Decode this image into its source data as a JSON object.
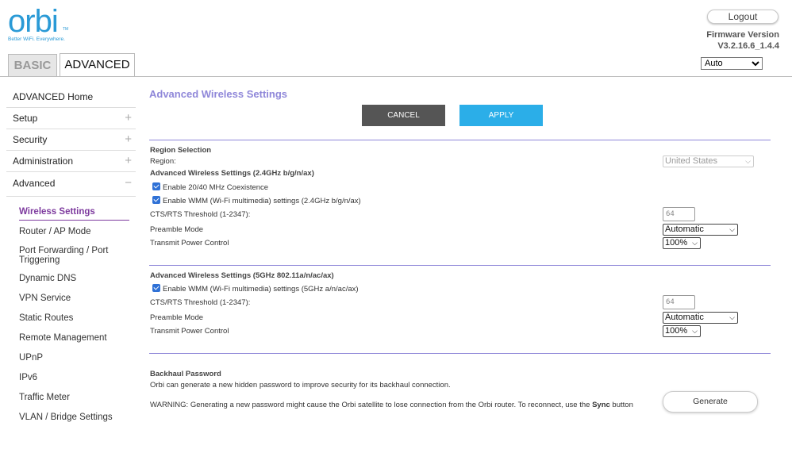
{
  "brand": {
    "logo": "orbi",
    "tm": "TM",
    "tagline": "Better WiFi. Everywhere."
  },
  "header": {
    "logout": "Logout",
    "firmware_label": "Firmware Version",
    "firmware_version": "V3.2.16.6_1.4.4",
    "language_selected": "Auto"
  },
  "tabs": [
    {
      "label": "BASIC"
    },
    {
      "label": "ADVANCED"
    }
  ],
  "sidebar": {
    "top": [
      {
        "label": "ADVANCED Home",
        "sign": ""
      },
      {
        "label": "Setup",
        "sign": "+"
      },
      {
        "label": "Security",
        "sign": "+"
      },
      {
        "label": "Administration",
        "sign": "+"
      },
      {
        "label": "Advanced",
        "sign": "−"
      }
    ],
    "sub": [
      "Wireless Settings",
      "Router / AP Mode",
      "Port Forwarding / Port Triggering",
      "Dynamic DNS",
      "VPN Service",
      "Static Routes",
      "Remote Management",
      "UPnP",
      "IPv6",
      "Traffic Meter",
      "VLAN / Bridge Settings"
    ]
  },
  "main": {
    "title": "Advanced Wireless Settings",
    "cancel": "CANCEL",
    "apply": "APPLY",
    "region": {
      "heading": "Region Selection",
      "label": "Region:",
      "value": "United States"
    },
    "band24": {
      "heading": "Advanced Wireless Settings (2.4GHz b/g/n/ax)",
      "coexistence": "Enable 20/40 MHz Coexistence",
      "wmm": "Enable WMM (Wi-Fi multimedia) settings (2.4GHz b/g/n/ax)",
      "cts_label": "CTS/RTS Threshold (1-2347):",
      "cts_value": "64",
      "preamble_label": "Preamble Mode",
      "preamble_value": "Automatic",
      "power_label": "Transmit Power Control",
      "power_value": "100%"
    },
    "band5": {
      "heading": "Advanced Wireless Settings (5GHz 802.11a/n/ac/ax)",
      "wmm": "Enable WMM (Wi-Fi multimedia) settings (5GHz a/n/ac/ax)",
      "cts_label": "CTS/RTS Threshold (1-2347):",
      "cts_value": "64",
      "preamble_label": "Preamble Mode",
      "preamble_value": "Automatic",
      "power_label": "Transmit Power Control",
      "power_value": "100%"
    },
    "backhaul": {
      "heading": "Backhaul Password",
      "desc": "Orbi can generate a new hidden password to improve security for its backhaul connection.",
      "warning_prefix": "WARNING: Generating a new password might cause the Orbi satellite to lose connection from the Orbi router. To reconnect, use the ",
      "warning_sync": "Sync",
      "warning_suffix": " button",
      "generate": "Generate"
    }
  }
}
